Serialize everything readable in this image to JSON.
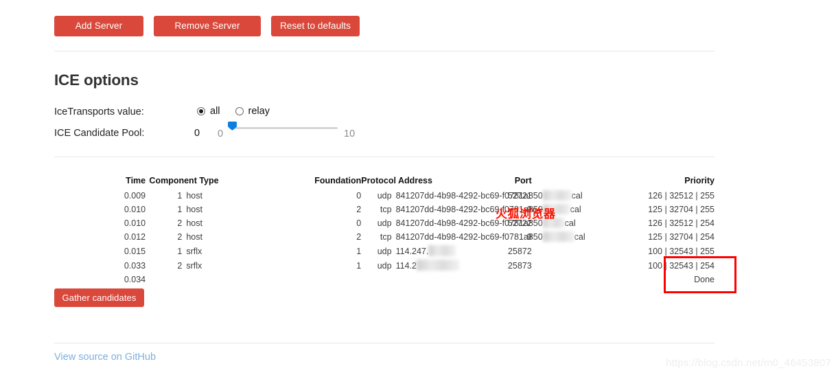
{
  "toolbar": {
    "add_server": "Add Server",
    "remove_server": "Remove Server",
    "reset_defaults": "Reset to defaults"
  },
  "ice_options": {
    "title": "ICE options",
    "transports_label": "IceTransports value:",
    "transports_options": [
      "all",
      "relay"
    ],
    "transports_selected": "all",
    "pool_label": "ICE Candidate Pool:",
    "pool_value": "0",
    "pool_min": "0",
    "pool_max": "10"
  },
  "candidates": {
    "headers": {
      "time": "Time",
      "component_type": "Component Type",
      "foundation": "Foundation",
      "protocol_address": "Protocol Address",
      "port": "Port",
      "priority": "Priority"
    },
    "rows": [
      {
        "time": "0.009",
        "component": "1",
        "type": "host",
        "foundation": "0",
        "protocol": "udp",
        "address_prefix": "841207dd-4b98-4292-bc69-f0781a850",
        "address_suffix": "cal",
        "port": "52721",
        "priority": "126 | 32512 | 255"
      },
      {
        "time": "0.010",
        "component": "1",
        "type": "host",
        "foundation": "2",
        "protocol": "tcp",
        "address_prefix": "841207dd-4b98-4292-bc69-f0781a850",
        "address_suffix": "cal",
        "port": "9",
        "priority": "125 | 32704 | 255"
      },
      {
        "time": "0.010",
        "component": "2",
        "type": "host",
        "foundation": "0",
        "protocol": "udp",
        "address_prefix": "841207dd-4b98-4292-bc69-f0781a850",
        "address_suffix": "cal",
        "port": "52722",
        "priority": "126 | 32512 | 254"
      },
      {
        "time": "0.012",
        "component": "2",
        "type": "host",
        "foundation": "2",
        "protocol": "tcp",
        "address_prefix": "841207dd-4b98-4292-bc69-f0781a850",
        "address_suffix": "cal",
        "port": "9",
        "priority": "125 | 32704 | 254"
      },
      {
        "time": "0.015",
        "component": "1",
        "type": "srflx",
        "foundation": "1",
        "protocol": "udp",
        "address_prefix": "114.247.",
        "address_suffix": "",
        "port": "25872",
        "priority": "100 | 32543 | 255"
      },
      {
        "time": "0.033",
        "component": "2",
        "type": "srflx",
        "foundation": "1",
        "protocol": "udp",
        "address_prefix": "114.2",
        "address_suffix": "",
        "port": "25873",
        "priority": "100 | 32543 | 254"
      }
    ],
    "final_row": {
      "time": "0.034",
      "status": "Done"
    }
  },
  "actions": {
    "gather_candidates": "Gather candidates"
  },
  "footer": {
    "github_link": "View source on GitHub",
    "watermark": "https://blog.csdn.net/m0_46453807"
  },
  "annotations": {
    "browser_note": "火狐浏览器"
  },
  "colors": {
    "button": "#d9483b",
    "annotation_red": "#fb1404",
    "box_red": "#ff0000",
    "link_blue": "#7eaee0",
    "slider_blue": "#0a7fe0"
  }
}
